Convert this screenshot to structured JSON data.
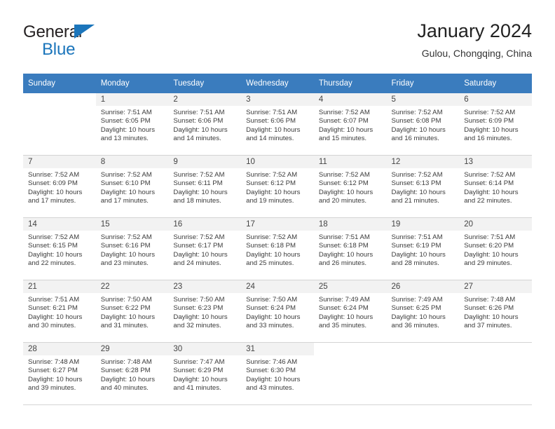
{
  "brand": {
    "name_primary": "General",
    "name_secondary": "Blue",
    "accent_color": "#1b75bb"
  },
  "header": {
    "title": "January 2024",
    "subtitle": "Gulou, Chongqing, China",
    "header_bg_color": "#3a7cbe"
  },
  "calendar": {
    "weekday_headers": [
      "Sunday",
      "Monday",
      "Tuesday",
      "Wednesday",
      "Thursday",
      "Friday",
      "Saturday"
    ],
    "weeks": [
      [
        {
          "day": "",
          "sunrise": "",
          "sunset": "",
          "daylight_line1": "",
          "daylight_line2": ""
        },
        {
          "day": "1",
          "sunrise": "Sunrise: 7:51 AM",
          "sunset": "Sunset: 6:05 PM",
          "daylight_line1": "Daylight: 10 hours",
          "daylight_line2": "and 13 minutes."
        },
        {
          "day": "2",
          "sunrise": "Sunrise: 7:51 AM",
          "sunset": "Sunset: 6:06 PM",
          "daylight_line1": "Daylight: 10 hours",
          "daylight_line2": "and 14 minutes."
        },
        {
          "day": "3",
          "sunrise": "Sunrise: 7:51 AM",
          "sunset": "Sunset: 6:06 PM",
          "daylight_line1": "Daylight: 10 hours",
          "daylight_line2": "and 14 minutes."
        },
        {
          "day": "4",
          "sunrise": "Sunrise: 7:52 AM",
          "sunset": "Sunset: 6:07 PM",
          "daylight_line1": "Daylight: 10 hours",
          "daylight_line2": "and 15 minutes."
        },
        {
          "day": "5",
          "sunrise": "Sunrise: 7:52 AM",
          "sunset": "Sunset: 6:08 PM",
          "daylight_line1": "Daylight: 10 hours",
          "daylight_line2": "and 16 minutes."
        },
        {
          "day": "6",
          "sunrise": "Sunrise: 7:52 AM",
          "sunset": "Sunset: 6:09 PM",
          "daylight_line1": "Daylight: 10 hours",
          "daylight_line2": "and 16 minutes."
        }
      ],
      [
        {
          "day": "7",
          "sunrise": "Sunrise: 7:52 AM",
          "sunset": "Sunset: 6:09 PM",
          "daylight_line1": "Daylight: 10 hours",
          "daylight_line2": "and 17 minutes."
        },
        {
          "day": "8",
          "sunrise": "Sunrise: 7:52 AM",
          "sunset": "Sunset: 6:10 PM",
          "daylight_line1": "Daylight: 10 hours",
          "daylight_line2": "and 17 minutes."
        },
        {
          "day": "9",
          "sunrise": "Sunrise: 7:52 AM",
          "sunset": "Sunset: 6:11 PM",
          "daylight_line1": "Daylight: 10 hours",
          "daylight_line2": "and 18 minutes."
        },
        {
          "day": "10",
          "sunrise": "Sunrise: 7:52 AM",
          "sunset": "Sunset: 6:12 PM",
          "daylight_line1": "Daylight: 10 hours",
          "daylight_line2": "and 19 minutes."
        },
        {
          "day": "11",
          "sunrise": "Sunrise: 7:52 AM",
          "sunset": "Sunset: 6:12 PM",
          "daylight_line1": "Daylight: 10 hours",
          "daylight_line2": "and 20 minutes."
        },
        {
          "day": "12",
          "sunrise": "Sunrise: 7:52 AM",
          "sunset": "Sunset: 6:13 PM",
          "daylight_line1": "Daylight: 10 hours",
          "daylight_line2": "and 21 minutes."
        },
        {
          "day": "13",
          "sunrise": "Sunrise: 7:52 AM",
          "sunset": "Sunset: 6:14 PM",
          "daylight_line1": "Daylight: 10 hours",
          "daylight_line2": "and 22 minutes."
        }
      ],
      [
        {
          "day": "14",
          "sunrise": "Sunrise: 7:52 AM",
          "sunset": "Sunset: 6:15 PM",
          "daylight_line1": "Daylight: 10 hours",
          "daylight_line2": "and 22 minutes."
        },
        {
          "day": "15",
          "sunrise": "Sunrise: 7:52 AM",
          "sunset": "Sunset: 6:16 PM",
          "daylight_line1": "Daylight: 10 hours",
          "daylight_line2": "and 23 minutes."
        },
        {
          "day": "16",
          "sunrise": "Sunrise: 7:52 AM",
          "sunset": "Sunset: 6:17 PM",
          "daylight_line1": "Daylight: 10 hours",
          "daylight_line2": "and 24 minutes."
        },
        {
          "day": "17",
          "sunrise": "Sunrise: 7:52 AM",
          "sunset": "Sunset: 6:18 PM",
          "daylight_line1": "Daylight: 10 hours",
          "daylight_line2": "and 25 minutes."
        },
        {
          "day": "18",
          "sunrise": "Sunrise: 7:51 AM",
          "sunset": "Sunset: 6:18 PM",
          "daylight_line1": "Daylight: 10 hours",
          "daylight_line2": "and 26 minutes."
        },
        {
          "day": "19",
          "sunrise": "Sunrise: 7:51 AM",
          "sunset": "Sunset: 6:19 PM",
          "daylight_line1": "Daylight: 10 hours",
          "daylight_line2": "and 28 minutes."
        },
        {
          "day": "20",
          "sunrise": "Sunrise: 7:51 AM",
          "sunset": "Sunset: 6:20 PM",
          "daylight_line1": "Daylight: 10 hours",
          "daylight_line2": "and 29 minutes."
        }
      ],
      [
        {
          "day": "21",
          "sunrise": "Sunrise: 7:51 AM",
          "sunset": "Sunset: 6:21 PM",
          "daylight_line1": "Daylight: 10 hours",
          "daylight_line2": "and 30 minutes."
        },
        {
          "day": "22",
          "sunrise": "Sunrise: 7:50 AM",
          "sunset": "Sunset: 6:22 PM",
          "daylight_line1": "Daylight: 10 hours",
          "daylight_line2": "and 31 minutes."
        },
        {
          "day": "23",
          "sunrise": "Sunrise: 7:50 AM",
          "sunset": "Sunset: 6:23 PM",
          "daylight_line1": "Daylight: 10 hours",
          "daylight_line2": "and 32 minutes."
        },
        {
          "day": "24",
          "sunrise": "Sunrise: 7:50 AM",
          "sunset": "Sunset: 6:24 PM",
          "daylight_line1": "Daylight: 10 hours",
          "daylight_line2": "and 33 minutes."
        },
        {
          "day": "25",
          "sunrise": "Sunrise: 7:49 AM",
          "sunset": "Sunset: 6:24 PM",
          "daylight_line1": "Daylight: 10 hours",
          "daylight_line2": "and 35 minutes."
        },
        {
          "day": "26",
          "sunrise": "Sunrise: 7:49 AM",
          "sunset": "Sunset: 6:25 PM",
          "daylight_line1": "Daylight: 10 hours",
          "daylight_line2": "and 36 minutes."
        },
        {
          "day": "27",
          "sunrise": "Sunrise: 7:48 AM",
          "sunset": "Sunset: 6:26 PM",
          "daylight_line1": "Daylight: 10 hours",
          "daylight_line2": "and 37 minutes."
        }
      ],
      [
        {
          "day": "28",
          "sunrise": "Sunrise: 7:48 AM",
          "sunset": "Sunset: 6:27 PM",
          "daylight_line1": "Daylight: 10 hours",
          "daylight_line2": "and 39 minutes."
        },
        {
          "day": "29",
          "sunrise": "Sunrise: 7:48 AM",
          "sunset": "Sunset: 6:28 PM",
          "daylight_line1": "Daylight: 10 hours",
          "daylight_line2": "and 40 minutes."
        },
        {
          "day": "30",
          "sunrise": "Sunrise: 7:47 AM",
          "sunset": "Sunset: 6:29 PM",
          "daylight_line1": "Daylight: 10 hours",
          "daylight_line2": "and 41 minutes."
        },
        {
          "day": "31",
          "sunrise": "Sunrise: 7:46 AM",
          "sunset": "Sunset: 6:30 PM",
          "daylight_line1": "Daylight: 10 hours",
          "daylight_line2": "and 43 minutes."
        },
        {
          "day": "",
          "sunrise": "",
          "sunset": "",
          "daylight_line1": "",
          "daylight_line2": ""
        },
        {
          "day": "",
          "sunrise": "",
          "sunset": "",
          "daylight_line1": "",
          "daylight_line2": ""
        },
        {
          "day": "",
          "sunrise": "",
          "sunset": "",
          "daylight_line1": "",
          "daylight_line2": ""
        }
      ]
    ]
  }
}
